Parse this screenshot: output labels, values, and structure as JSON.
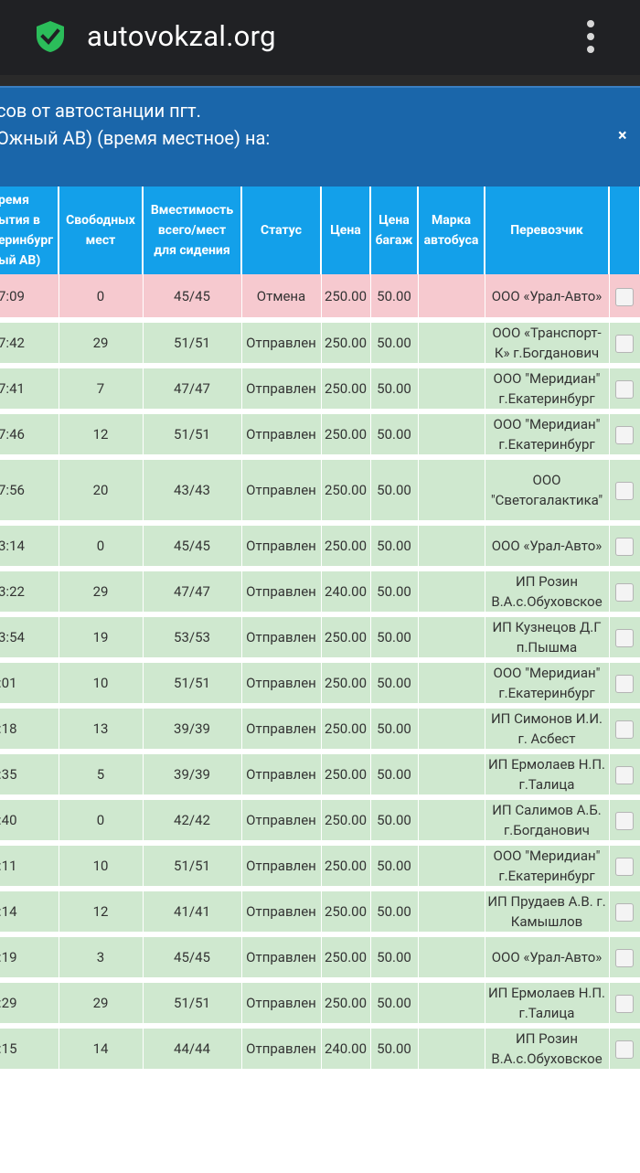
{
  "browser": {
    "url": "autovokzal.org",
    "secure_icon": "shield-check-icon",
    "menu_icon": "kebab-menu-icon"
  },
  "modal": {
    "title_line1": "сов от автостанции пгт.",
    "title_line2": "Ожный АВ) (время местное) на:",
    "close_label": "×"
  },
  "colors": {
    "browser_bar": "#202124",
    "modal_header": "#1a66aa",
    "table_header": "#13a0ea",
    "row_cancelled": "#f6c9cf",
    "row_departed": "#cfe8cf",
    "secure_icon": "#2bbd5a"
  },
  "table": {
    "headers": {
      "time": "ремя\nытия в\nеринбург\nый АВ)",
      "free": "Свободных\nмест",
      "capacity": "Вместимость\nвсего/мест\nдля сидения",
      "status": "Статус",
      "price": "Цена",
      "baggage": "Цена\nбагаж",
      "brand": "Марка\nавтобуса",
      "carrier": "Перевозчик"
    },
    "rows": [
      {
        "time": "7:09",
        "free": "0",
        "capacity": "45/45",
        "status": "Отмена",
        "price": "250.00",
        "baggage": "50.00",
        "brand": "",
        "carrier": "ООО «Урал-Авто»",
        "state": "cancel"
      },
      {
        "time": "7:42",
        "free": "29",
        "capacity": "51/51",
        "status": "Отправлен",
        "price": "250.00",
        "baggage": "50.00",
        "brand": "",
        "carrier": "ООО «Транспорт-К» г.Богданович",
        "state": "sent"
      },
      {
        "time": "7:41",
        "free": "7",
        "capacity": "47/47",
        "status": "Отправлен",
        "price": "250.00",
        "baggage": "50.00",
        "brand": "",
        "carrier": "ООО \"Меридиан\" г.Екатеринбург",
        "state": "sent"
      },
      {
        "time": "7:46",
        "free": "12",
        "capacity": "51/51",
        "status": "Отправлен",
        "price": "250.00",
        "baggage": "50.00",
        "brand": "",
        "carrier": "ООО \"Меридиан\" г.Екатеринбург",
        "state": "sent"
      },
      {
        "time": "7:56",
        "free": "20",
        "capacity": "43/43",
        "status": "Отправлен",
        "price": "250.00",
        "baggage": "50.00",
        "brand": "",
        "carrier": "ООО \"Светогалактика\"",
        "state": "sent"
      },
      {
        "time": "3:14",
        "free": "0",
        "capacity": "45/45",
        "status": "Отправлен",
        "price": "250.00",
        "baggage": "50.00",
        "brand": "",
        "carrier": "ООО «Урал-Авто»",
        "state": "sent"
      },
      {
        "time": "3:22",
        "free": "29",
        "capacity": "47/47",
        "status": "Отправлен",
        "price": "240.00",
        "baggage": "50.00",
        "brand": "",
        "carrier": "ИП Розин В.А.с.Обуховское",
        "state": "sent"
      },
      {
        "time": "3:54",
        "free": "19",
        "capacity": "53/53",
        "status": "Отправлен",
        "price": "250.00",
        "baggage": "50.00",
        "brand": "",
        "carrier": "ИП Кузнецов Д.Г п.Пышма",
        "state": "sent"
      },
      {
        "time": ":01",
        "free": "10",
        "capacity": "51/51",
        "status": "Отправлен",
        "price": "250.00",
        "baggage": "50.00",
        "brand": "",
        "carrier": "ООО \"Меридиан\" г.Екатеринбург",
        "state": "sent"
      },
      {
        "time": ":18",
        "free": "13",
        "capacity": "39/39",
        "status": "Отправлен",
        "price": "250.00",
        "baggage": "50.00",
        "brand": "",
        "carrier": "ИП Симонов И.И. г. Асбест",
        "state": "sent"
      },
      {
        "time": ":35",
        "free": "5",
        "capacity": "39/39",
        "status": "Отправлен",
        "price": "250.00",
        "baggage": "50.00",
        "brand": "",
        "carrier": "ИП Ермолаев Н.П. г.Талица",
        "state": "sent"
      },
      {
        "time": ":40",
        "free": "0",
        "capacity": "42/42",
        "status": "Отправлен",
        "price": "250.00",
        "baggage": "50.00",
        "brand": "",
        "carrier": "ИП Салимов А.Б. г.Богданович",
        "state": "sent"
      },
      {
        "time": ":11",
        "free": "10",
        "capacity": "51/51",
        "status": "Отправлен",
        "price": "250.00",
        "baggage": "50.00",
        "brand": "",
        "carrier": "ООО \"Меридиан\" г.Екатеринбург",
        "state": "sent"
      },
      {
        "time": ":14",
        "free": "12",
        "capacity": "41/41",
        "status": "Отправлен",
        "price": "250.00",
        "baggage": "50.00",
        "brand": "",
        "carrier": "ИП Прудаев А.В. г. Камышлов",
        "state": "sent"
      },
      {
        "time": ":19",
        "free": "3",
        "capacity": "45/45",
        "status": "Отправлен",
        "price": "250.00",
        "baggage": "50.00",
        "brand": "",
        "carrier": "ООО «Урал-Авто»",
        "state": "sent"
      },
      {
        "time": ":29",
        "free": "29",
        "capacity": "51/51",
        "status": "Отправлен",
        "price": "250.00",
        "baggage": "50.00",
        "brand": "",
        "carrier": "ИП Ермолаев Н.П. г.Талица",
        "state": "sent"
      },
      {
        "time": ":15",
        "free": "14",
        "capacity": "44/44",
        "status": "Отправлен",
        "price": "240.00",
        "baggage": "50.00",
        "brand": "",
        "carrier": "ИП Розин В.А.с.Обуховское",
        "state": "sent"
      }
    ]
  }
}
